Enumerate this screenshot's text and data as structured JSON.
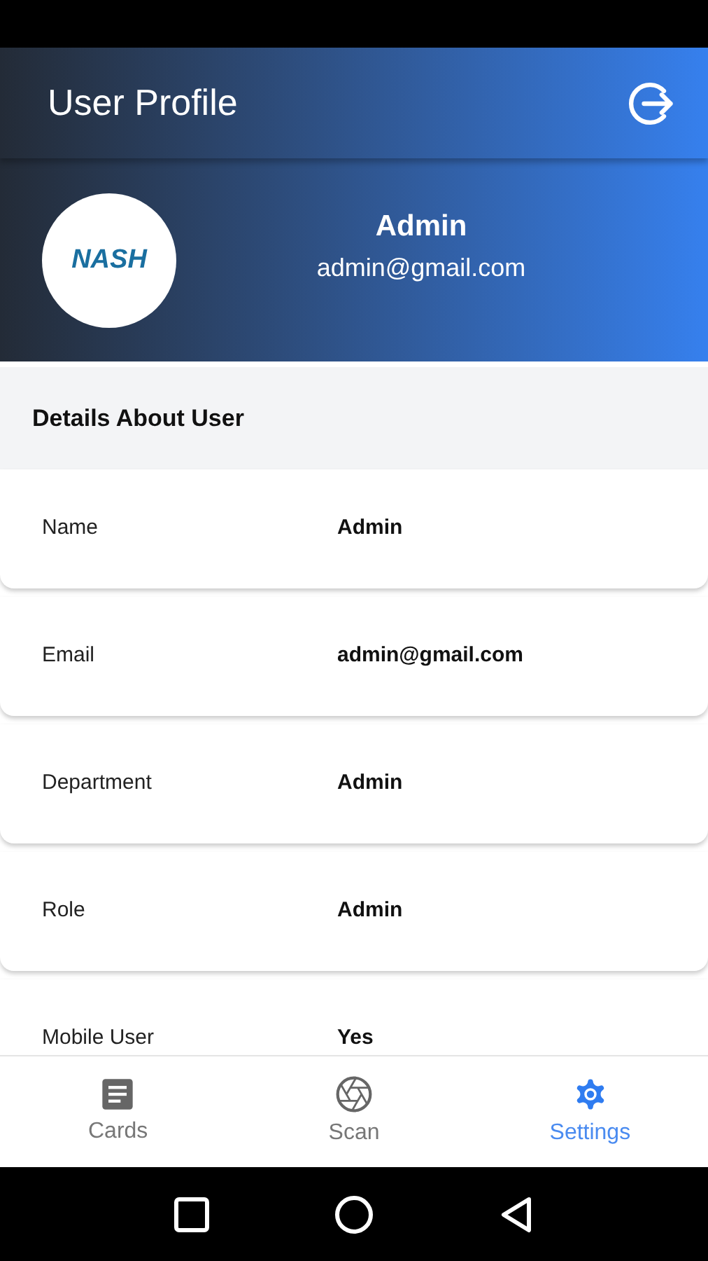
{
  "header": {
    "title": "User Profile"
  },
  "profile": {
    "logo_text": "NASH",
    "name": "Admin",
    "email": "admin@gmail.com"
  },
  "details": {
    "title": "Details About User",
    "rows": [
      {
        "label": "Name",
        "value": "Admin"
      },
      {
        "label": "Email",
        "value": "admin@gmail.com"
      },
      {
        "label": "Department",
        "value": "Admin"
      },
      {
        "label": "Role",
        "value": "Admin"
      },
      {
        "label": "Mobile User",
        "value": "Yes"
      }
    ]
  },
  "bottom_nav": [
    {
      "label": "Cards",
      "kind": "cards",
      "selected": false
    },
    {
      "label": "Scan",
      "kind": "scan",
      "selected": false
    },
    {
      "label": "Settings",
      "kind": "settings",
      "selected": true
    }
  ]
}
